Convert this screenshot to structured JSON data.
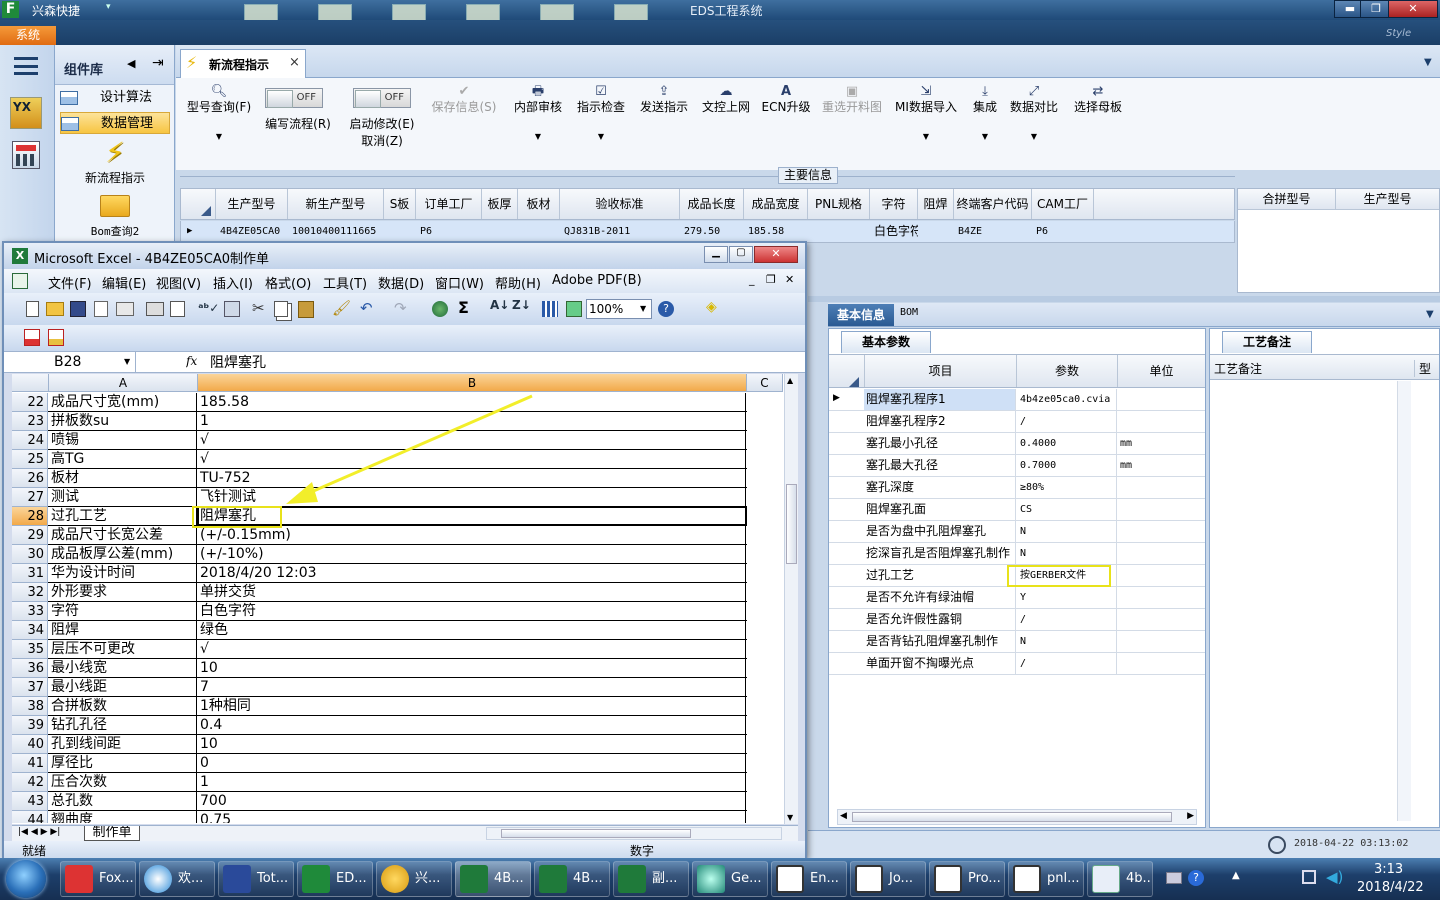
{
  "app": {
    "brand_icon": "F",
    "name": "兴森快捷",
    "window_title": "EDS工程系统",
    "system_tab": "系统",
    "style_label": "Style",
    "minimize": "▬",
    "maximize": "❐",
    "close": "✕"
  },
  "nav": {
    "header": "组件库",
    "items": [
      "设计算法",
      "数据管理"
    ],
    "big_items": [
      "新流程指示",
      "Bom查询2"
    ]
  },
  "tab": {
    "label": "新流程指示",
    "close": "×"
  },
  "toolbar": {
    "type_query": "型号查询(F)",
    "edit_flow": "编写流程(R)",
    "edit_flow_state": "OFF",
    "enable_modify": "启动修改(E)",
    "enable_modify_sub": "取消(Z)",
    "enable_modify_state": "OFF",
    "save_info": "保存信息(S)",
    "internal_review": "内部审核",
    "instruction_check": "指示检查",
    "send_instruction": "发送指示",
    "control_upload": "文控上网",
    "ecn_upgrade": "ECN升级",
    "reselect_material": "重选开料图",
    "mi_import": "MI数据导入",
    "integrate": "集成",
    "data_compare": "数据对比",
    "select_master": "选择母板"
  },
  "main_info": {
    "section_title": "主要信息",
    "columns": [
      "生产型号",
      "新生产型号",
      "S板",
      "订单工厂",
      "板厚",
      "板材",
      "验收标准",
      "成品长度",
      "成品宽度",
      "PNL规格",
      "字符",
      "阻焊",
      "终端客户代码",
      "CAM工厂"
    ],
    "row": [
      "4B4ZE05CA0",
      "10010400111665",
      "",
      "P6",
      "",
      "",
      "QJ831B-2011",
      "279.50",
      "185.58",
      "",
      "白色字符",
      "",
      "B4ZE",
      "P6"
    ]
  },
  "right_grid": {
    "columns": [
      "合拼型号",
      "生产型号"
    ]
  },
  "detail": {
    "tabs": [
      "基本信息",
      "BOM"
    ],
    "sub_tab": "基本参数",
    "notes_tab": "工艺备注",
    "notes_col": "工艺备注",
    "notes_col2": "型",
    "columns": [
      "项目",
      "参数",
      "单位"
    ],
    "rows": [
      {
        "item": "阻焊塞孔程序1",
        "value": "4b4ze05ca0.cvia",
        "unit": ""
      },
      {
        "item": "阻焊塞孔程序2",
        "value": "/",
        "unit": ""
      },
      {
        "item": "塞孔最小孔径",
        "value": "0.4000",
        "unit": "mm"
      },
      {
        "item": "塞孔最大孔径",
        "value": "0.7000",
        "unit": "mm"
      },
      {
        "item": "塞孔深度",
        "value": "≥80%",
        "unit": ""
      },
      {
        "item": "阻焊塞孔面",
        "value": "CS",
        "unit": ""
      },
      {
        "item": "是否为盘中孔阻焊塞孔",
        "value": "N",
        "unit": ""
      },
      {
        "item": "挖深盲孔是否阻焊塞孔制作",
        "value": "N",
        "unit": ""
      },
      {
        "item": "过孔工艺",
        "value": "按GERBER文件",
        "unit": ""
      },
      {
        "item": "是否不允许有绿油帽",
        "value": "Y",
        "unit": ""
      },
      {
        "item": "是否允许假性露铜",
        "value": "/",
        "unit": ""
      },
      {
        "item": "是否背钻孔阻焊塞孔制作",
        "value": "N",
        "unit": ""
      },
      {
        "item": "单面开窗不掏曝光点",
        "value": "/",
        "unit": ""
      }
    ]
  },
  "datetime": "2018-04-22 03:13:02",
  "excel": {
    "title": "Microsoft Excel - 4B4ZE05CA0制作单",
    "menu": [
      "文件(F)",
      "编辑(E)",
      "视图(V)",
      "插入(I)",
      "格式(O)",
      "工具(T)",
      "数据(D)",
      "窗口(W)",
      "帮助(H)",
      "Adobe PDF(B)"
    ],
    "zoom": "100%",
    "name_box": "B28",
    "fx": "fx",
    "formula": "阻焊塞孔",
    "col_a": "A",
    "col_b": "B",
    "col_c": "C",
    "rows": [
      {
        "n": "22",
        "a": "成品尺寸宽(mm)",
        "b": "185.58"
      },
      {
        "n": "23",
        "a": "拼板数su",
        "b": "1"
      },
      {
        "n": "24",
        "a": "喷锡",
        "b": "√"
      },
      {
        "n": "25",
        "a": "高TG",
        "b": "√"
      },
      {
        "n": "26",
        "a": "板材",
        "b": "TU-752"
      },
      {
        "n": "27",
        "a": "测试",
        "b": "飞针测试"
      },
      {
        "n": "28",
        "a": "过孔工艺",
        "b": "阻焊塞孔"
      },
      {
        "n": "29",
        "a": "成品尺寸长宽公差",
        "b": "(+/-0.15mm)"
      },
      {
        "n": "30",
        "a": "成品板厚公差(mm)",
        "b": "(+/-10%)"
      },
      {
        "n": "31",
        "a": "华为设计时间",
        "b": "2018/4/20 12:03"
      },
      {
        "n": "32",
        "a": "外形要求",
        "b": "单拼交货"
      },
      {
        "n": "33",
        "a": "字符",
        "b": "白色字符"
      },
      {
        "n": "34",
        "a": "阻焊",
        "b": "绿色"
      },
      {
        "n": "35",
        "a": "层压不可更改",
        "b": "√"
      },
      {
        "n": "36",
        "a": "最小线宽",
        "b": "10"
      },
      {
        "n": "37",
        "a": "最小线距",
        "b": "7"
      },
      {
        "n": "38",
        "a": "合拼板数",
        "b": "1种相同"
      },
      {
        "n": "39",
        "a": "钻孔孔径",
        "b": "0.4"
      },
      {
        "n": "40",
        "a": "孔到线间距",
        "b": "10"
      },
      {
        "n": "41",
        "a": "厚径比",
        "b": "0"
      },
      {
        "n": "42",
        "a": "压合次数",
        "b": "1"
      },
      {
        "n": "43",
        "a": "总孔数",
        "b": "700"
      },
      {
        "n": "44",
        "a": "翘曲度",
        "b": "0.75"
      }
    ],
    "sheet_tab": "制作单",
    "status_ready": "就绪",
    "status_num": "数字"
  },
  "taskbar": {
    "items": [
      "Fox...",
      "欢...",
      "Tot...",
      "ED...",
      "兴...",
      "4B...",
      "4B...",
      "副...",
      "Ge...",
      "En...",
      "Jo...",
      "Pro...",
      "pnl...",
      "4b..."
    ],
    "time": "3:13",
    "date": "2018/4/22"
  },
  "colors": {
    "highlight": "#e8e21a",
    "arrow": "#f2ee2a",
    "selection": "#cfe0f6",
    "accent": "#f07a1b"
  }
}
